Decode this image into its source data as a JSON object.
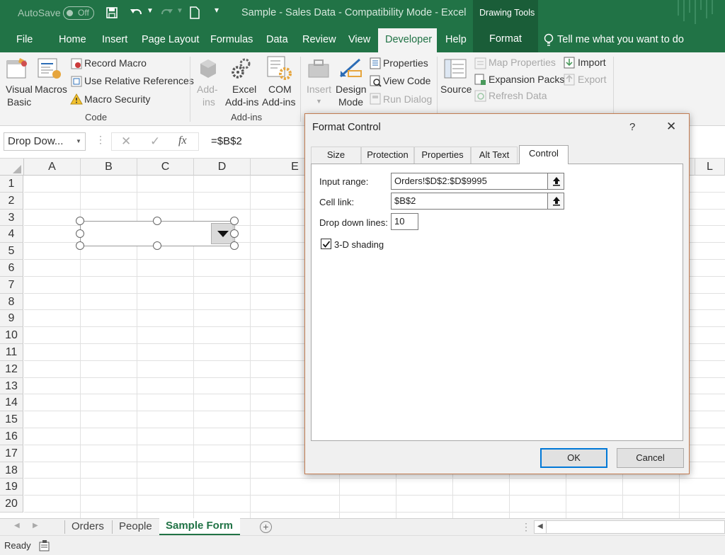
{
  "titlebar": {
    "autosave_label": "AutoSave",
    "autosave_state": "Off",
    "document_title": "Sample - Sales Data - Compatibility Mode - Excel",
    "context_tools": "Drawing Tools"
  },
  "tabs": {
    "file": "File",
    "home": "Home",
    "insert": "Insert",
    "page_layout": "Page Layout",
    "formulas": "Formulas",
    "data": "Data",
    "review": "Review",
    "view": "View",
    "developer": "Developer",
    "help": "Help",
    "format": "Format",
    "tell_me": "Tell me what you want to do"
  },
  "ribbon": {
    "visual_basic": [
      "Visual",
      "Basic"
    ],
    "macros": "Macros",
    "record_macro": "Record Macro",
    "use_relative": "Use Relative References",
    "macro_security": "Macro Security",
    "group_code": "Code",
    "addins": [
      "Add-",
      "ins"
    ],
    "excel_addins": [
      "Excel",
      "Add-ins"
    ],
    "com_addins": [
      "COM",
      "Add-ins"
    ],
    "group_addins": "Add-ins",
    "insert": "Insert",
    "design_mode": [
      "Design",
      "Mode"
    ],
    "properties": "Properties",
    "view_code": "View Code",
    "run_dialog": "Run Dialog",
    "source": "Source",
    "map_properties": "Map Properties",
    "expansion_packs": "Expansion Packs",
    "refresh_data": "Refresh Data",
    "import": "Import",
    "export": "Export"
  },
  "formula_bar": {
    "name_box": "Drop Dow...",
    "fx": "fx",
    "formula": "=$B$2"
  },
  "columns": [
    "A",
    "B",
    "C",
    "D",
    "E",
    "L"
  ],
  "rows": [
    "1",
    "2",
    "3",
    "4",
    "5",
    "6",
    "7",
    "8",
    "9",
    "10",
    "11",
    "12",
    "13",
    "14",
    "15",
    "16",
    "17",
    "18",
    "19",
    "20"
  ],
  "dialog": {
    "title": "Format Control",
    "help": "?",
    "close": "✕",
    "tabs": [
      "Size",
      "Protection",
      "Properties",
      "Alt Text",
      "Control"
    ],
    "active_tab": "Control",
    "input_range_label": "Input range:",
    "input_range_value": "Orders!$D$2:$D$9995",
    "cell_link_label": "Cell link:",
    "cell_link_value": "$B$2",
    "drop_down_lines_label": "Drop down lines:",
    "drop_down_lines_value": "10",
    "shading_label": "3-D shading",
    "shading_checked": true,
    "ok": "OK",
    "cancel": "Cancel"
  },
  "sheets": {
    "tabs": [
      "Orders",
      "People",
      "Sample Form"
    ],
    "active": "Sample Form"
  },
  "status": {
    "ready": "Ready"
  },
  "colors": {
    "brand": "#217346",
    "dialog_border": "#c27c52",
    "ok_border": "#0078d7"
  }
}
